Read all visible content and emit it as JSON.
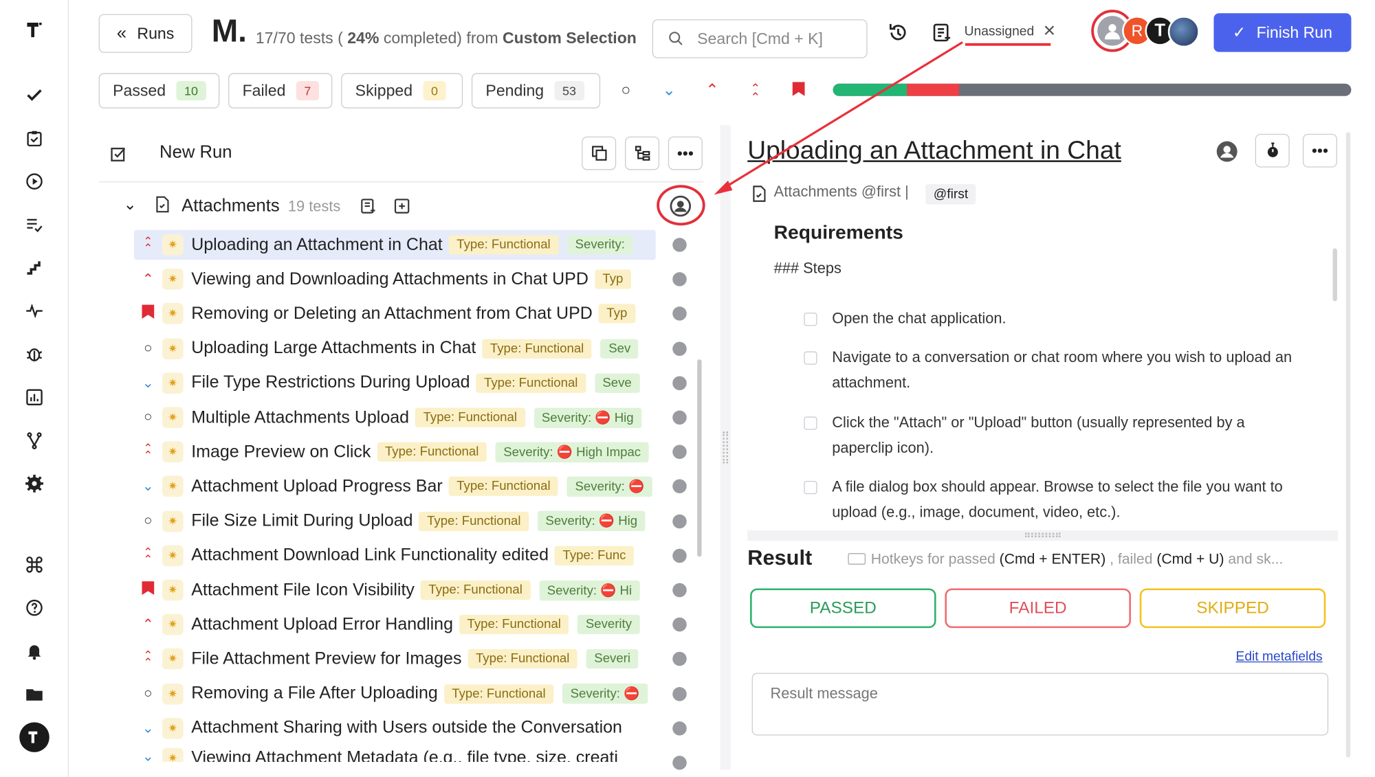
{
  "header": {
    "runs_label": "Runs",
    "run_initial": "M.",
    "progress_text": "17/70 tests ( ",
    "percent": "24%",
    "progress_mid": " completed) from ",
    "selection": "Custom Selection",
    "search_placeholder": "Search [Cmd + K]",
    "assignee": "Unassigned",
    "avatar_letters": [
      "R",
      "T"
    ],
    "finish_label": "Finish Run"
  },
  "filters": [
    {
      "label": "Passed",
      "count": "10",
      "bg": "#dff3d8",
      "fg": "#3d7a2b"
    },
    {
      "label": "Failed",
      "count": "7",
      "bg": "#fde1e1",
      "fg": "#c43030"
    },
    {
      "label": "Skipped",
      "count": "0",
      "bg": "#fdf2cc",
      "fg": "#9a7a10"
    },
    {
      "label": "Pending",
      "count": "53",
      "bg": "#f0f0f0",
      "fg": "#444"
    }
  ],
  "progress": {
    "passed": 0.143,
    "failed": 0.1,
    "colors": {
      "passed": "#22b573",
      "failed": "#ee3f45",
      "pending": "#6b6f78"
    }
  },
  "left_panel": {
    "new_run_label": "New Run",
    "suite_name": "Attachments",
    "suite_count": "19 tests"
  },
  "tests": [
    {
      "title": "Uploading an Attachment in Chat",
      "type": "Type: Functional",
      "sev": "Severity:",
      "prio": "⌃⌃",
      "pc": "#e02b35",
      "selected": true
    },
    {
      "title": "Viewing and Downloading Attachments in Chat UPD",
      "type": "Typ",
      "sev": "",
      "prio": "⌃",
      "pc": "#e02b35"
    },
    {
      "title": "Removing or Deleting an Attachment from Chat UPD",
      "type": "Typ",
      "sev": "",
      "prio": "flag",
      "pc": "#e02b35"
    },
    {
      "title": "Uploading Large Attachments in Chat",
      "type": "Type: Functional",
      "sev": "Sev",
      "prio": "○",
      "pc": "#333"
    },
    {
      "title": "File Type Restrictions During Upload",
      "type": "Type: Functional",
      "sev": "Seve",
      "prio": "⌄",
      "pc": "#3b8fd8"
    },
    {
      "title": "Multiple Attachments Upload",
      "type": "Type: Functional",
      "sev": "Severity: ⛔ Hig",
      "prio": "○",
      "pc": "#333"
    },
    {
      "title": "Image Preview on Click",
      "type": "Type: Functional",
      "sev": "Severity: ⛔ High Impac",
      "prio": "⌃⌃",
      "pc": "#e02b35"
    },
    {
      "title": "Attachment Upload Progress Bar",
      "type": "Type: Functional",
      "sev": "Severity: ⛔",
      "prio": "⌄",
      "pc": "#3b8fd8"
    },
    {
      "title": "File Size Limit During Upload",
      "type": "Type: Functional",
      "sev": "Severity: ⛔ Hig",
      "prio": "○",
      "pc": "#333"
    },
    {
      "title": "Attachment Download Link Functionality edited",
      "type": "Type: Func",
      "sev": "",
      "prio": "⌃⌃",
      "pc": "#e02b35"
    },
    {
      "title": "Attachment File Icon Visibility",
      "type": "Type: Functional",
      "sev": "Severity: ⛔ Hi",
      "prio": "flag",
      "pc": "#e02b35"
    },
    {
      "title": "Attachment Upload Error Handling",
      "type": "Type: Functional",
      "sev": "Severity",
      "prio": "⌃",
      "pc": "#e02b35"
    },
    {
      "title": "File Attachment Preview for Images",
      "type": "Type: Functional",
      "sev": "Severi",
      "prio": "⌃⌃",
      "pc": "#e02b35"
    },
    {
      "title": "Removing a File After Uploading",
      "type": "Type: Functional",
      "sev": "Severity: ⛔",
      "prio": "○",
      "pc": "#333"
    },
    {
      "title": "Attachment Sharing with Users outside the Conversation",
      "type": "",
      "sev": "",
      "prio": "⌄",
      "pc": "#3b8fd8"
    },
    {
      "title": "Viewing Attachment Metadata (e.g., file type, size, creati",
      "type": "",
      "sev": "",
      "prio": "⌄",
      "pc": "#3b8fd8"
    }
  ],
  "detail": {
    "title": "Uploading an Attachment in Chat",
    "suite_crumb": "Attachments @first |",
    "tag": "@first",
    "requirements": "Requirements",
    "steps_heading": "### Steps",
    "steps": [
      "Open the chat application.",
      "Navigate to a conversation or chat room where you wish to upload an attachment.",
      "Click the \"Attach\" or \"Upload\" button (usually represented by a paperclip icon).",
      "A file dialog box should appear. Browse to select the file you want to upload (e.g., image, document, video, etc.)."
    ],
    "result_label": "Result",
    "hotkeys_a": "Hotkeys for passed ",
    "hotkeys_b": "(Cmd + ENTER)",
    "hotkeys_c": " , failed ",
    "hotkeys_d": "(Cmd + U)",
    "hotkeys_e": " and sk...",
    "passed_btn": "PASSED",
    "failed_btn": "FAILED",
    "skipped_btn": "SKIPPED",
    "edit_metafields": "Edit metafields",
    "result_placeholder": "Result message"
  }
}
